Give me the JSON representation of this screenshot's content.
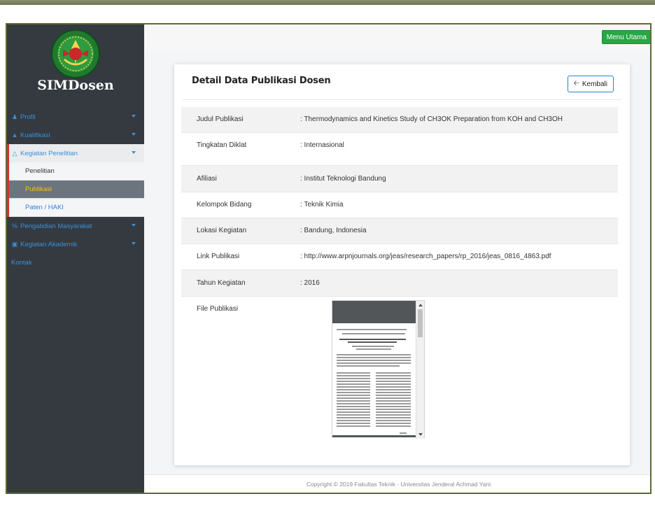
{
  "app": {
    "brand": "SIMDosen"
  },
  "header": {
    "menu_utama_label": "Menu Utama"
  },
  "sidebar": {
    "items": [
      {
        "label": "Profil",
        "icon": "user-icon"
      },
      {
        "label": "Kualifikasi",
        "icon": "graduation-cap-icon"
      },
      {
        "label": "Kegiatan Penelitian",
        "icon": "flask-icon"
      },
      {
        "label": "Pengabdian Masyarakat",
        "icon": "percent-icon"
      },
      {
        "label": "Kegiatan Akademik",
        "icon": "chalkboard-icon"
      },
      {
        "label": "Kontak",
        "icon": ""
      }
    ],
    "subitems": [
      {
        "label": "Penelitian"
      },
      {
        "label": "Publikasi"
      },
      {
        "label": "Paten / HAKI"
      }
    ]
  },
  "card": {
    "title": "Detail Data Publikasi Dosen",
    "back_label": "Kembali",
    "rows": [
      {
        "label": "Judul Publikasi",
        "value": ": Thermodynamics and Kinetics Study of CH3OK Preparation from KOH and CH3OH"
      },
      {
        "label": "Tingkatan Diklat",
        "value": ": Internasional"
      },
      {
        "label": "Afiliasi",
        "value": ": Institut Teknologi Bandung"
      },
      {
        "label": "Kelompok Bidang",
        "value": ": Teknik Kimia"
      },
      {
        "label": "Lokasi Kegiatan",
        "value": ": Bandung, Indonesia"
      },
      {
        "label": "Link Publikasi",
        "value": ": http://www.arpnjournals.org/jeas/research_papers/rp_2016/jeas_0816_4863.pdf"
      },
      {
        "label": "Tahun Kegiatan",
        "value": ": 2016"
      },
      {
        "label": "File Publikasi",
        "value": ""
      }
    ]
  },
  "footer": {
    "text": "Copyright © 2019 Fakultas Teknik - Universitas Jenderal Achmad Yani"
  },
  "colors": {
    "sidebar_bg": "#343a40",
    "accent_blue": "#3b8fd9",
    "active_red": "#d9302b",
    "success_green": "#28a745",
    "highlight_yellow": "#ffc107"
  }
}
